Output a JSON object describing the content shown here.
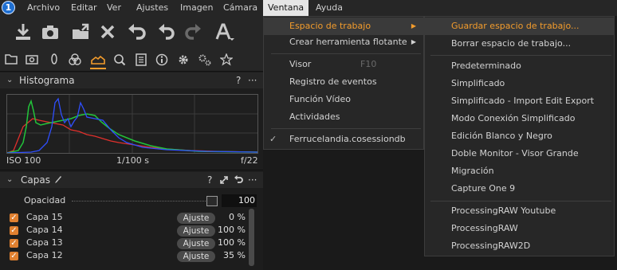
{
  "menubar": {
    "items": [
      "Archivo",
      "Editar",
      "Ver",
      "Ajustes",
      "Imagen",
      "Cámara",
      "Ventana",
      "Ayuda"
    ],
    "active": "Ventana"
  },
  "toolbar": {
    "icons": [
      "import-icon",
      "camera-icon",
      "export-folder-icon",
      "close-icon",
      "undo-history-icon",
      "undo-icon",
      "redo-icon",
      "text-icon"
    ]
  },
  "tabs": {
    "icons": [
      "folder-icon",
      "camera-tab-icon",
      "lens-icon",
      "color-icon",
      "exposure-icon",
      "details-icon",
      "metadata-icon",
      "info-icon",
      "settings-icon",
      "adjustments-icon",
      "star-icon"
    ]
  },
  "histogram": {
    "title": "Histograma",
    "help": "?",
    "more": "···",
    "iso": "ISO 100",
    "shutter": "1/100 s",
    "aperture": "f/22"
  },
  "layers": {
    "title": "Capas",
    "help": "?",
    "opacity_label": "Opacidad",
    "opacity_value": "100",
    "rows": [
      {
        "name": "Capa 15",
        "button": "Ajuste",
        "value": "0 %"
      },
      {
        "name": "Capa 14",
        "button": "Ajuste",
        "value": "100 %"
      },
      {
        "name": "Capa 13",
        "button": "Ajuste",
        "value": "100 %"
      },
      {
        "name": "Capa 12",
        "button": "Ajuste",
        "value": "35 %"
      }
    ]
  },
  "ventana_menu": {
    "items": [
      {
        "label": "Espacio de trabajo",
        "submenu": true,
        "highlighted": true
      },
      {
        "label": "Crear herramienta flotante",
        "submenu": true
      },
      {
        "label": "Visor",
        "shortcut": "F10"
      },
      {
        "label": "Registro de eventos"
      },
      {
        "label": "Función Vídeo"
      },
      {
        "label": "Actividades"
      },
      {
        "label": "Ferrucelandia.cosessiondb",
        "checked": true
      }
    ]
  },
  "workspace_menu": {
    "items": [
      {
        "label": "Guardar espacio de trabajo...",
        "highlighted": true
      },
      {
        "label": "Borrar espacio de trabajo..."
      },
      {
        "label": "Predeterminado"
      },
      {
        "label": "Simplificado"
      },
      {
        "label": "Simplificado - Import Edit Export"
      },
      {
        "label": "Modo Conexión Simplificado"
      },
      {
        "label": "Edición Blanco y Negro"
      },
      {
        "label": "Doble Monitor - Visor Grande"
      },
      {
        "label": "Migración"
      },
      {
        "label": "Capture One 9"
      },
      {
        "label": "ProcessingRAW Youtube"
      },
      {
        "label": "ProcessingRAW"
      },
      {
        "label": "ProcessingRAW2D"
      }
    ]
  },
  "colors": {
    "accent": "#f39c2c",
    "checkbox": "#e08030",
    "histo_blue": "#2f4fff",
    "histo_green": "#22c43a",
    "histo_red": "#e0302c"
  }
}
